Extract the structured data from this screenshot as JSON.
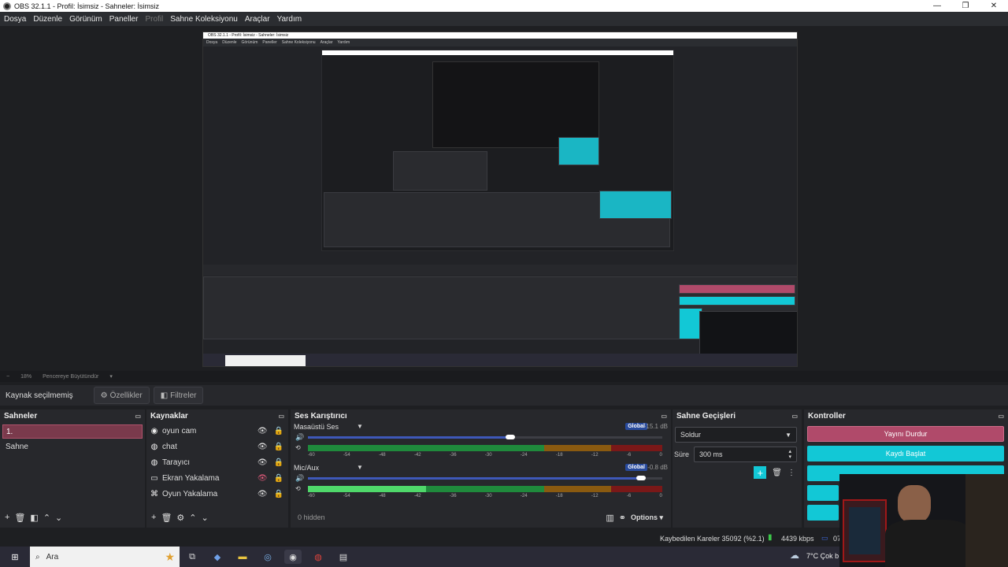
{
  "window": {
    "title": "OBS 32.1.1 - Profil: İsimsiz - Sahneler: İsimsiz",
    "buttons": [
      "—",
      "❐",
      "✕"
    ]
  },
  "menu": {
    "items": [
      "Dosya",
      "Düzenle",
      "Görünüm",
      "Paneller",
      "Profil",
      "Sahne Koleksiyonu",
      "Araçlar",
      "Yardım"
    ]
  },
  "zoom": {
    "level": "18%",
    "mode": "Pencereye Büyütündür"
  },
  "toolbar": {
    "no_source": "Kaynak seçilmemiş",
    "properties": "Özellikler",
    "filters": "Filtreler"
  },
  "scenes": {
    "title": "Sahneler",
    "items": [
      {
        "label": "1.",
        "selected": true
      },
      {
        "label": "Sahne",
        "selected": false
      }
    ]
  },
  "sources": {
    "title": "Kaynaklar",
    "items": [
      {
        "icon": "camera-icon",
        "label": "oyun cam"
      },
      {
        "icon": "globe-icon",
        "label": "chat"
      },
      {
        "icon": "globe-icon",
        "label": "Tarayıcı"
      },
      {
        "icon": "monitor-icon",
        "label": "Ekran Yakalama"
      },
      {
        "icon": "gamepad-icon",
        "label": "Oyun Yakalama"
      }
    ]
  },
  "mixer": {
    "title": "Ses Karıştırıcı",
    "channels": [
      {
        "name": "Masaüstü Ses",
        "badge": "Global",
        "db": "-15.1 dB",
        "level": 0.57
      },
      {
        "name": "Mic/Aux",
        "badge": "Global",
        "db": "-0.8 dB",
        "level": 0.94
      }
    ],
    "ticks": [
      "-60",
      "-54",
      "-48",
      "-42",
      "-36",
      "-30",
      "-24",
      "-18",
      "-12",
      "-6",
      "0"
    ],
    "hidden": "0 hidden",
    "options": "Options"
  },
  "transitions": {
    "title": "Sahne Geçişleri",
    "selected": "Soldur",
    "duration_label": "Süre",
    "duration": "300 ms"
  },
  "controls": {
    "title": "Kontroller",
    "stop_stream": "Yayını Durdur",
    "start_record": "Kaydı Başlat"
  },
  "status": {
    "dropped": "Kaybedilen Kareler 35092 (%2.1)",
    "bitrate": "4439 kbps",
    "extra": "07"
  },
  "taskbar": {
    "search_placeholder": "Ara",
    "weather": "7°C  Çok b"
  },
  "colors": {
    "accent_red": "#b04a6a",
    "accent_cyan": "#12c8d6",
    "global_blue": "#284a9c",
    "meter_green": "#1f8a3c",
    "meter_orange": "#8a5a10",
    "meter_red": "#7a1818"
  }
}
